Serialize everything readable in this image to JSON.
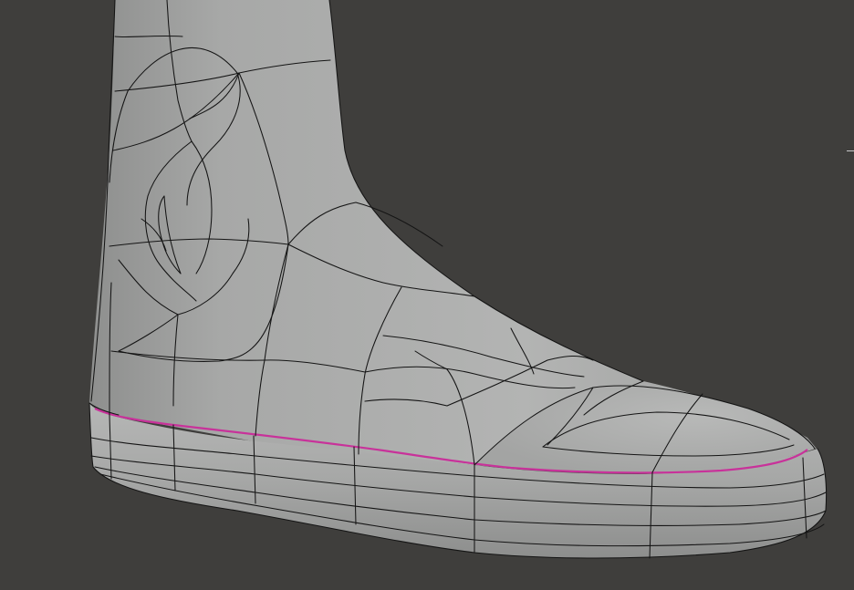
{
  "viewport": {
    "background_color": "#3f3e3c",
    "mesh_color": "#a9aaa9",
    "wire_color": "#141414",
    "selected_edge_color": "#c8329a"
  },
  "scene": {
    "object": "boot-mesh",
    "mode": "edit-wireframe-overlay",
    "selected_edge_loop": "sole-top-edge-loop"
  },
  "icons": [
    "axis-gizmo-tick-icon"
  ]
}
